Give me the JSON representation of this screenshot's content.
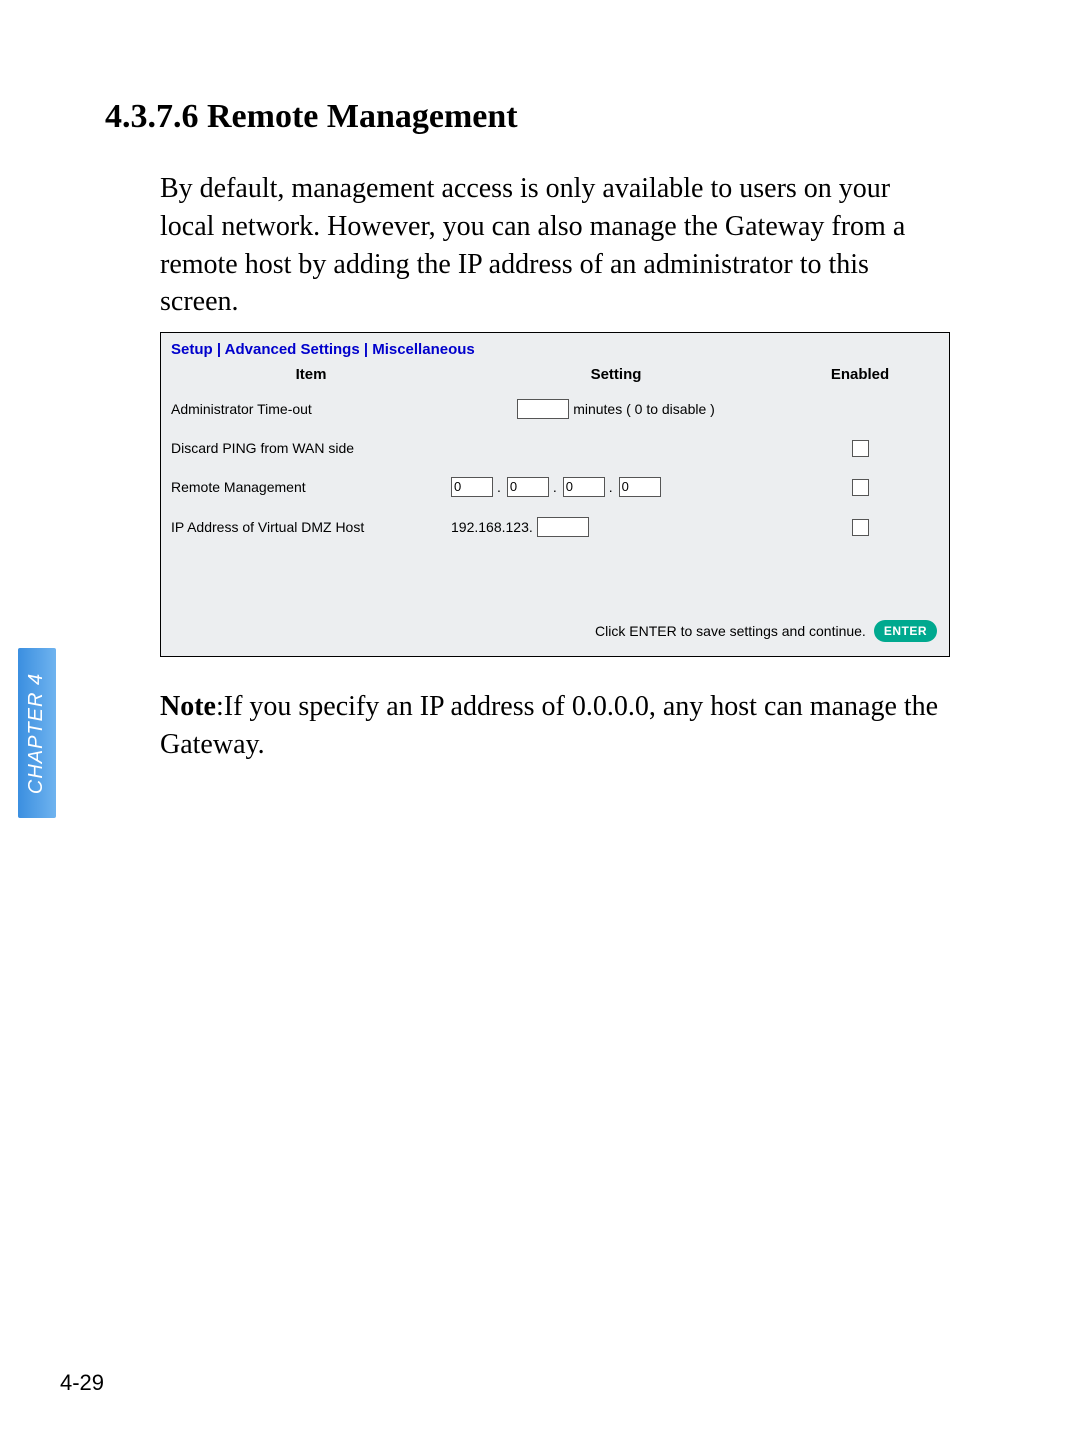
{
  "chapter_tab": "CHAPTER 4",
  "heading": "4.3.7.6 Remote Management",
  "paragraph": "By default, management access is only available to users on your local network. However, you can also manage the Gateway from a remote host by adding the IP address of an administrator to this screen.",
  "note_bold": "Note",
  "note_rest": ":If you specify an IP address of 0.0.0.0, any host can manage the Gateway.",
  "page_number": "4-29",
  "ui": {
    "breadcrumb": "Setup | Advanced Settings | Miscellaneous",
    "headers": {
      "item": "Item",
      "setting": "Setting",
      "enabled": "Enabled"
    },
    "rows": {
      "timeout": {
        "label": "Administrator Time-out",
        "value": "",
        "suffix": "minutes ( 0 to disable )"
      },
      "discard_ping": {
        "label": "Discard PING from WAN side"
      },
      "remote": {
        "label": "Remote Management",
        "oct1": "0",
        "oct2": "0",
        "oct3": "0",
        "oct4": "0"
      },
      "dmz": {
        "label": "IP Address of Virtual DMZ Host",
        "prefix": "192.168.123.",
        "value": ""
      }
    },
    "footer": {
      "hint": "Click ENTER to save settings and continue.",
      "button": "ENTER"
    }
  }
}
